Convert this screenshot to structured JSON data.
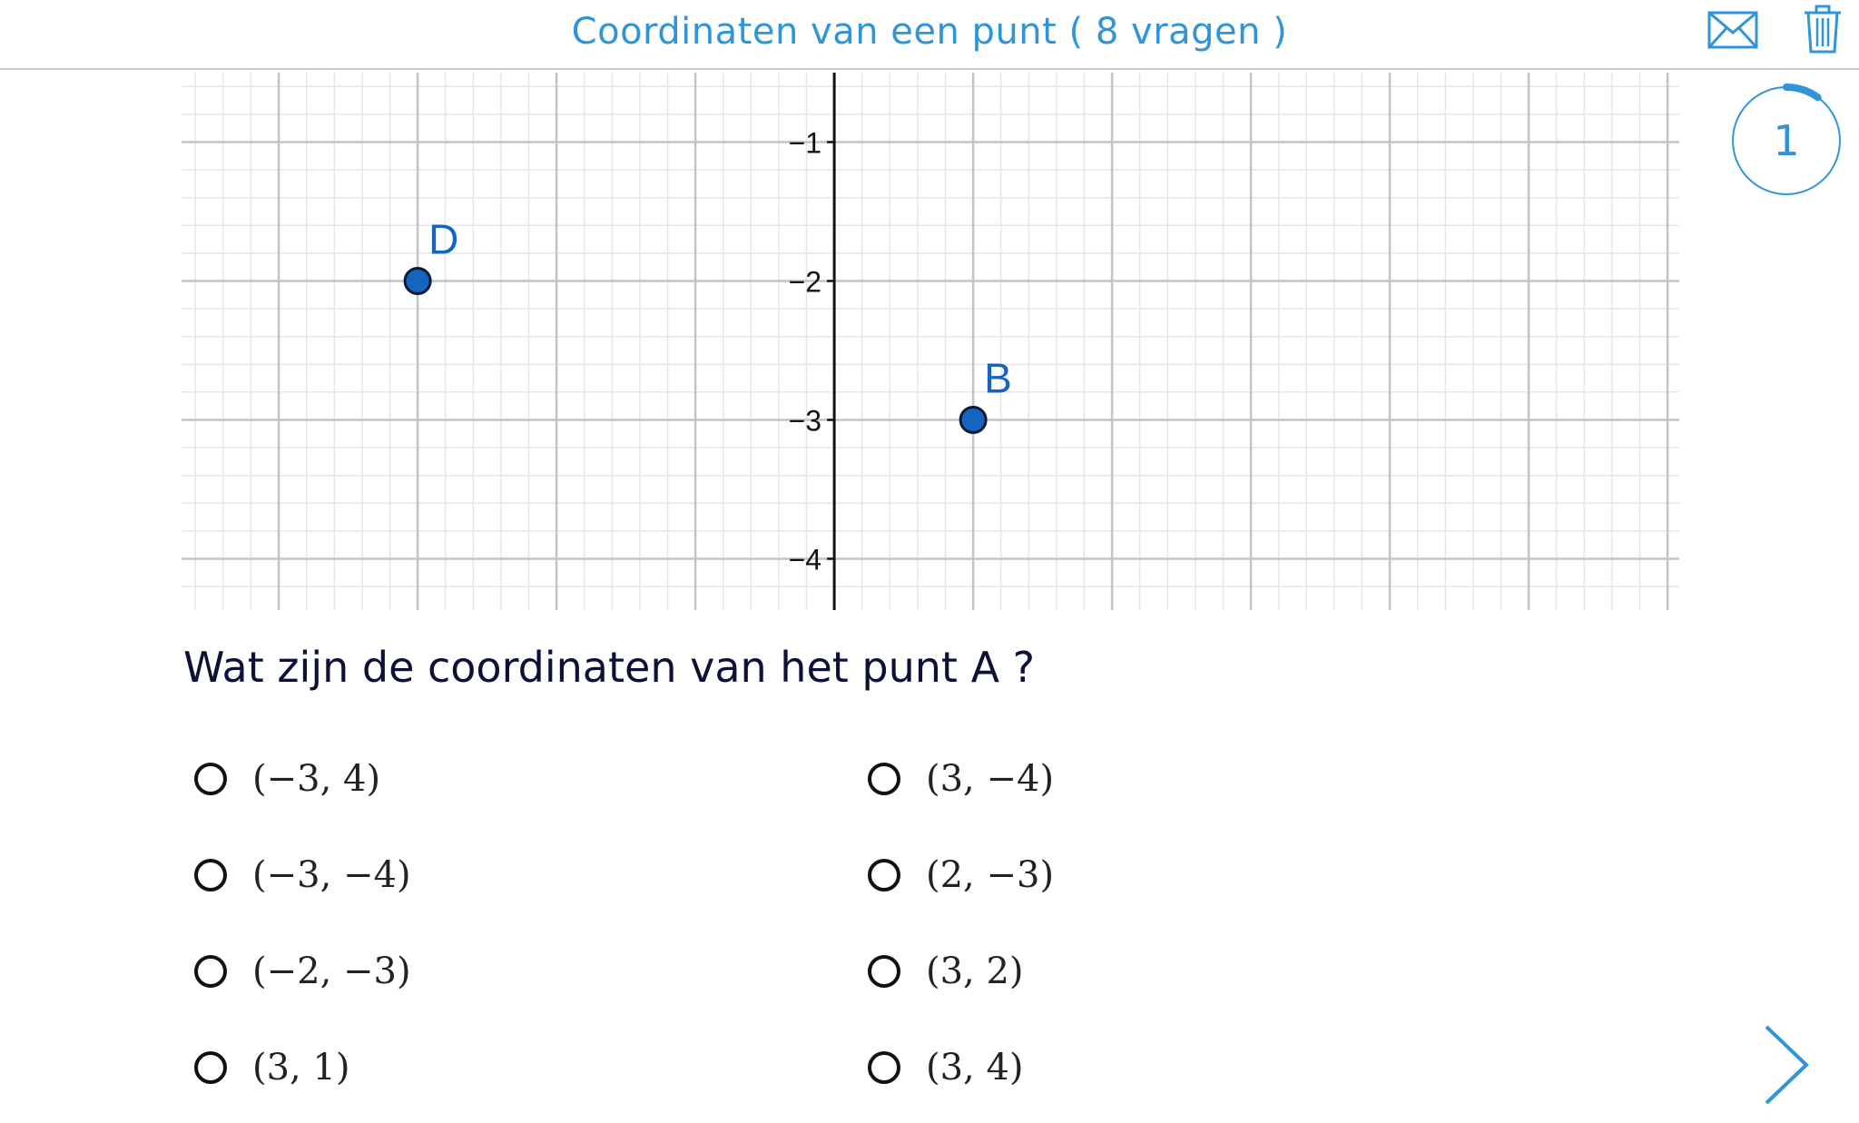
{
  "header": {
    "title": "Coordinaten van een punt ( 8 vragen )",
    "icons": [
      "mail-icon",
      "trash-icon"
    ]
  },
  "progress": {
    "number": "1",
    "fraction": 0.1
  },
  "graph": {
    "y_ticks": [
      "−1",
      "−2",
      "−3",
      "−4"
    ],
    "points": [
      {
        "label": "D",
        "x": -3,
        "y": -2
      },
      {
        "label": "B",
        "x": 1,
        "y": -3
      }
    ],
    "visible_x_range": [
      -4.7,
      6.0
    ],
    "visible_y_range": [
      -4.3,
      -0.5
    ],
    "point_color": "#1565c0"
  },
  "question": "Wat zijn de coordinaten van het punt A ?",
  "options": [
    "(−3, 4)",
    "(3, −4)",
    "(−3, −4)",
    "(2, −3)",
    "(−2, −3)",
    "(3, 2)",
    "(3, 1)",
    "(3, 4)"
  ],
  "colors": {
    "accent": "#2f95d8",
    "text": "#0d1137"
  }
}
